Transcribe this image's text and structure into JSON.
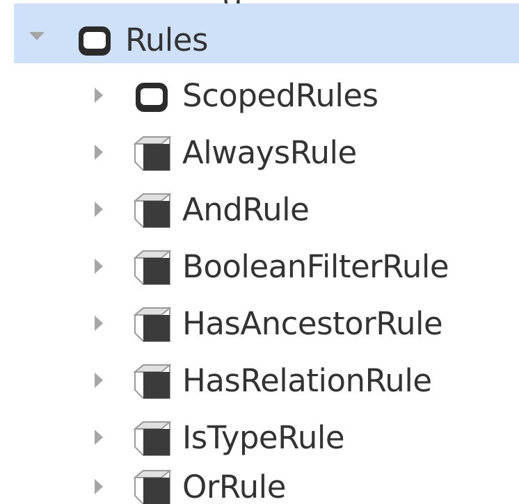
{
  "tree": {
    "top_partial": {
      "icon": "folder-icon",
      "label": "g"
    },
    "root": {
      "label": "Rules",
      "icon": "folder-icon",
      "expanded": true,
      "selected": true
    },
    "children": [
      {
        "label": "ScopedRules",
        "icon": "folder-icon"
      },
      {
        "label": "AlwaysRule",
        "icon": "cube-icon"
      },
      {
        "label": "AndRule",
        "icon": "cube-icon"
      },
      {
        "label": "BooleanFilterRule",
        "icon": "cube-icon"
      },
      {
        "label": "HasAncestorRule",
        "icon": "cube-icon"
      },
      {
        "label": "HasRelationRule",
        "icon": "cube-icon"
      },
      {
        "label": "IsTypeRule",
        "icon": "cube-icon"
      },
      {
        "label": "OrRule",
        "icon": "cube-icon"
      }
    ]
  },
  "colors": {
    "selection": "#cfe1f9",
    "text": "#333333",
    "arrow": "#a6a6a6",
    "icon_dark": "#2b2b2b"
  }
}
